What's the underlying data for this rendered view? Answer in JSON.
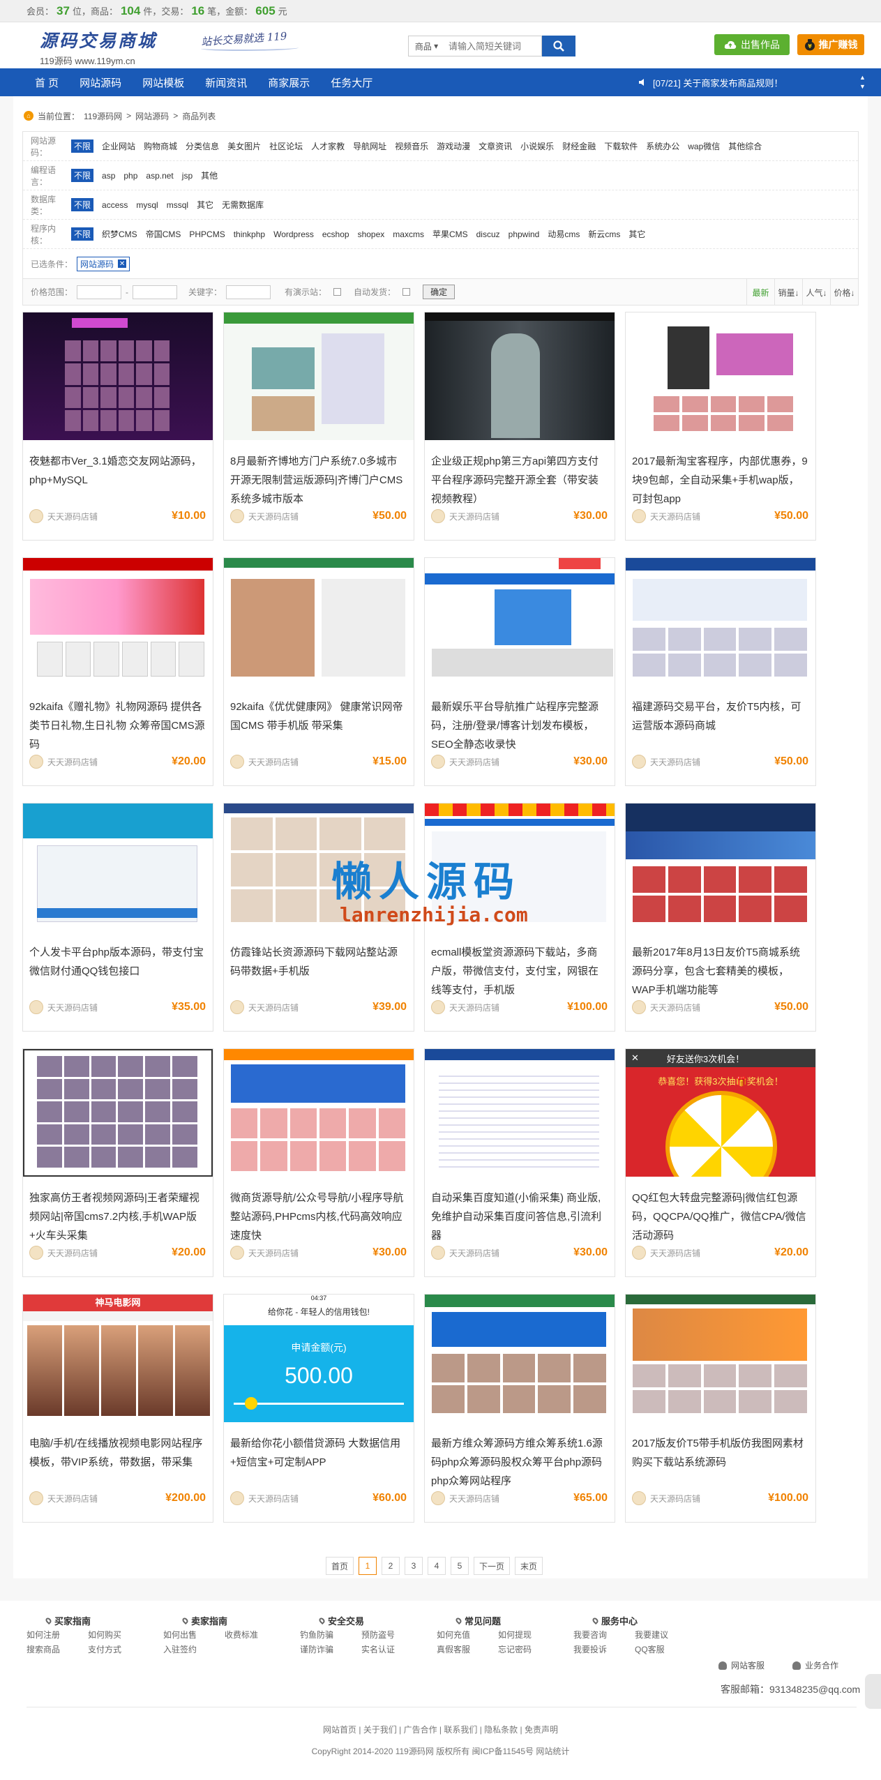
{
  "topbar": {
    "members_label": "会员：",
    "members": "37",
    "members_unit": "位，商品：",
    "goods": "104",
    "goods_unit": "件，交易：",
    "trades": "16",
    "trades_unit": "笔，金额：",
    "amount": "605",
    "amount_unit": "元"
  },
  "header": {
    "logo_title": "源码交易商城",
    "logo_sub": "119源码  www.119ym.cn",
    "slogan": "站长交易就选 119",
    "search_select": "商品",
    "search_placeholder": "请输入简短关键词",
    "sell_label": "出售作品",
    "promo_label": "推广赚钱"
  },
  "nav": {
    "items": [
      "首 页",
      "网站源码",
      "网站模板",
      "新闻资讯",
      "商家展示",
      "任务大厅"
    ],
    "notice": "[07/21] 关于商家发布商品规则！"
  },
  "breadcrumb": {
    "prefix": "当前位置：",
    "items": [
      "119源码网",
      "网站源码",
      "商品列表"
    ],
    "sep": ">"
  },
  "filters": {
    "rows": [
      {
        "label": "网站源码：",
        "options": [
          "不限",
          "企业网站",
          "购物商城",
          "分类信息",
          "美女图片",
          "社区论坛",
          "人才家教",
          "导航网址",
          "视频音乐",
          "游戏动漫",
          "文章资讯",
          "小说娱乐",
          "财经金融",
          "下载软件",
          "系统办公",
          "wap微信",
          "其他综合"
        ]
      },
      {
        "label": "编程语言：",
        "options": [
          "不限",
          "asp",
          "php",
          "asp.net",
          "jsp",
          "其他"
        ]
      },
      {
        "label": "数据库类：",
        "options": [
          "不限",
          "access",
          "mysql",
          "mssql",
          "其它",
          "无需数据库"
        ]
      },
      {
        "label": "程序内核：",
        "options": [
          "不限",
          "织梦CMS",
          "帝国CMS",
          "PHPCMS",
          "thinkphp",
          "Wordpress",
          "ecshop",
          "shopex",
          "maxcms",
          "苹果CMS",
          "discuz",
          "phpwind",
          "动易cms",
          "新云cms",
          "其它"
        ]
      }
    ],
    "chosen_label": "已选条件：",
    "chosen_tag": "网站源码"
  },
  "sortbar": {
    "price_label": "价格范围：",
    "keyword_label": "关键字：",
    "demo_label": "有演示站：",
    "auto_label": "自动发货：",
    "confirm": "确定",
    "sorts": [
      "最新",
      "销量↓",
      "人气↓",
      "价格↓"
    ]
  },
  "products": [
    {
      "title": "夜魅都市Ver_3.1婚恋交友网站源码，php+MySQL",
      "shop": "天天源码店铺",
      "price": "¥10.00"
    },
    {
      "title": "8月最新齐博地方门户系统7.0多城市开源无限制营运版源码|齐博门户CMS系统多城市版本",
      "shop": "天天源码店铺",
      "price": "¥50.00"
    },
    {
      "title": "企业级正规php第三方api第四方支付平台程序源码完整开源全套（带安装视频教程）",
      "shop": "天天源码店铺",
      "price": "¥30.00"
    },
    {
      "title": "2017最新淘宝客程序，内部优惠券，9块9包邮，全自动采集+手机wap版，可封包app",
      "shop": "天天源码店铺",
      "price": "¥50.00"
    },
    {
      "title": "92kaifa《赠礼物》礼物网源码 提供各类节日礼物,生日礼物 众筹帝国CMS源码",
      "shop": "天天源码店铺",
      "price": "¥20.00"
    },
    {
      "title": "92kaifa《优优健康网》 健康常识网帝国CMS 带手机版 带采集",
      "shop": "天天源码店铺",
      "price": "¥15.00"
    },
    {
      "title": "最新娱乐平台导航推广站程序完整源码，注册/登录/博客计划发布模板，SEO全静态收录快",
      "shop": "天天源码店铺",
      "price": "¥30.00"
    },
    {
      "title": "福建源码交易平台，友价T5内核，可运营版本源码商城",
      "shop": "天天源码店铺",
      "price": "¥50.00"
    },
    {
      "title": "个人发卡平台php版本源码，带支付宝微信财付通QQ钱包接口",
      "shop": "天天源码店铺",
      "price": "¥35.00"
    },
    {
      "title": "仿霞锋站长资源源码下载网站整站源码带数据+手机版",
      "shop": "天天源码店铺",
      "price": "¥39.00"
    },
    {
      "title": "ecmall模板堂资源源码下载站，多商户版，带微信支付，支付宝，网银在线等支付，手机版",
      "shop": "天天源码店铺",
      "price": "¥100.00"
    },
    {
      "title": "最新2017年8月13日友价T5商城系统源码分享，包含七套精美的模板，WAP手机端功能等",
      "shop": "天天源码店铺",
      "price": "¥50.00"
    },
    {
      "title": "独家高仿王者视频网源码|王者荣耀视频网站|帝国cms7.2内核,手机WAP版+火车头采集",
      "shop": "天天源码店铺",
      "price": "¥20.00"
    },
    {
      "title": "微商货源导航/公众号导航/小程序导航整站源码,PHPcms内核,代码高效响应速度快",
      "shop": "天天源码店铺",
      "price": "¥30.00"
    },
    {
      "title": "自动采集百度知道(小偷采集) 商业版,免维护自动采集百度问答信息,引流利器",
      "shop": "天天源码店铺",
      "price": "¥30.00"
    },
    {
      "title": "QQ红包大转盘完整源码|微信红包源码，QQCPA/QQ推广，微信CPA/微信活动源码",
      "shop": "天天源码店铺",
      "price": "¥20.00"
    },
    {
      "title": "电脑/手机/在线播放视频电影网站程序模板，带VIP系统，带数据，带采集",
      "shop": "天天源码店铺",
      "price": "¥200.00"
    },
    {
      "title": "最新给你花小额借贷源码 大数据信用+短信宝+可定制APP",
      "shop": "天天源码店铺",
      "price": "¥60.00"
    },
    {
      "title": "最新方维众筹源码方维众筹系统1.6源码php众筹源码股权众筹平台php源码php众筹网站程序",
      "shop": "天天源码店铺",
      "price": "¥65.00"
    },
    {
      "title": "2017版友价T5带手机版仿我图网素材购买下载站系统源码",
      "shop": "天天源码店铺",
      "price": "¥100.00"
    }
  ],
  "thumb_text": {
    "t13_banner": "好友送你3次机会！",
    "t13_sub": "恭喜您！获得3次抽🎁奖机会！",
    "t16_title": "神马电影网",
    "t17_top": "给你花 - 年轻人的信用钱包!",
    "t17_label": "申请金额(元)",
    "t17_amount": "500.00",
    "t17_status": "04:37"
  },
  "watermark": {
    "cn": "懒人源码",
    "en": "lanrenzhijia.com"
  },
  "pager": [
    "首页",
    "1",
    "2",
    "3",
    "4",
    "5",
    "下一页",
    "末页"
  ],
  "footer": {
    "cols": [
      {
        "title": "买家指南",
        "links": [
          "如何注册",
          "如何购买",
          "搜索商品",
          "支付方式"
        ]
      },
      {
        "title": "卖家指南",
        "links": [
          "如何出售",
          "收费标准",
          "入驻签约"
        ]
      },
      {
        "title": "安全交易",
        "links": [
          "钓鱼防骗",
          "预防盗号",
          "谨防诈骗",
          "实名认证"
        ]
      },
      {
        "title": "常见问题",
        "links": [
          "如何充值",
          "如何提现",
          "真假客服",
          "忘记密码"
        ]
      },
      {
        "title": "服务中心",
        "links": [
          "我要咨询",
          "我要建议",
          "我要投诉",
          "QQ客服"
        ]
      }
    ],
    "service": [
      "网站客服",
      "业务合作"
    ],
    "email": "客服邮箱：931348235@qq.com",
    "links": "网站首页 | 关于我们 | 广告合作 | 联系我们 | 隐私条款 | 免责声明",
    "copyright": "CopyRight 2014-2020 119源码网 版权所有 闽ICP备11545号 网站统计"
  }
}
